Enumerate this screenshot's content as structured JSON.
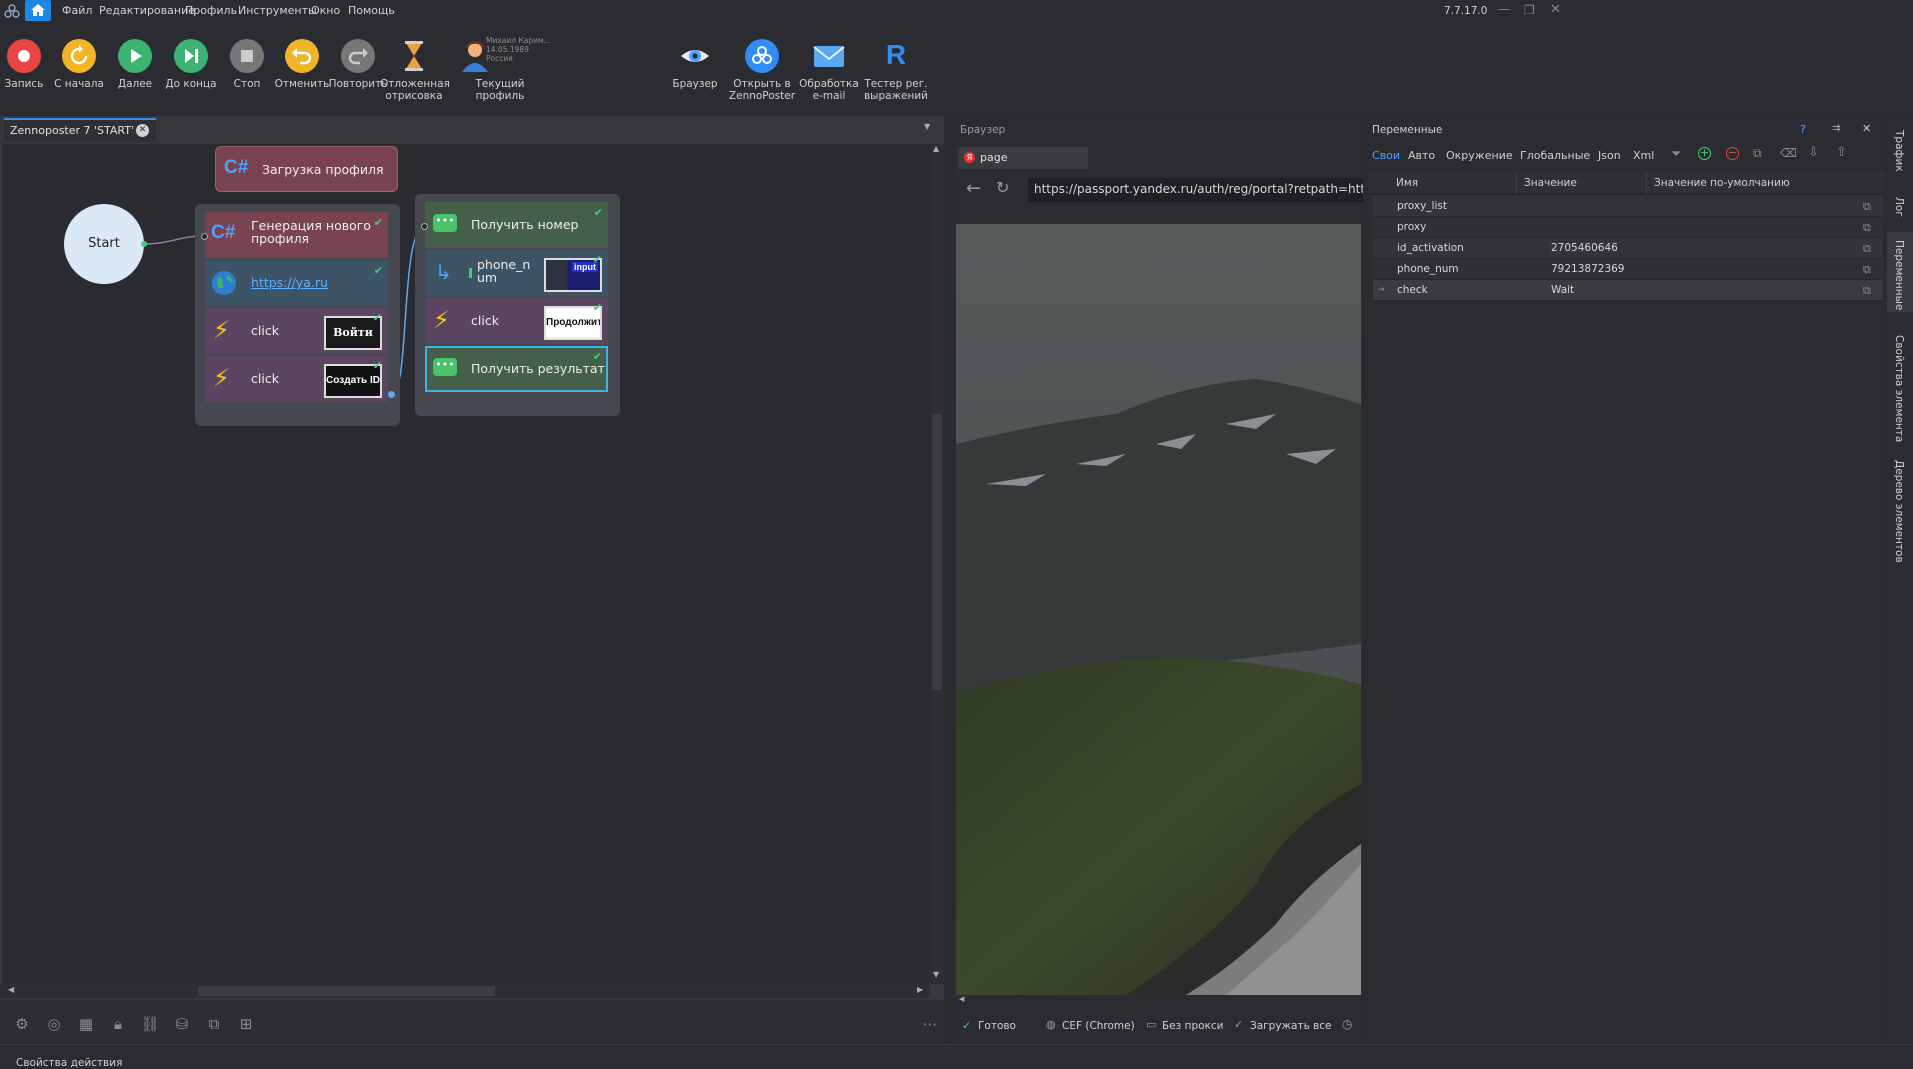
{
  "menu": {
    "items": [
      "Файл",
      "Редактирование",
      "Профиль",
      "Инструменты",
      "Окно",
      "Помощь"
    ],
    "version": "7.7.17.0"
  },
  "toolbar": {
    "buttons": [
      {
        "label": "Запись",
        "icon": "record-icon",
        "color": "#e84545"
      },
      {
        "label": "С начала",
        "icon": "restart-icon",
        "color": "#f0b429"
      },
      {
        "label": "Далее",
        "icon": "play-icon",
        "color": "#3cb371"
      },
      {
        "label": "До конца",
        "icon": "play-to-end-icon",
        "color": "#3cb371"
      },
      {
        "label": "Стоп",
        "icon": "stop-icon",
        "color": "#888888"
      },
      {
        "label": "Отменить",
        "icon": "undo-icon",
        "color": "#f0b429"
      },
      {
        "label": "Повторить",
        "icon": "redo-icon",
        "color": "#888888"
      },
      {
        "label": "Отложенная отрисовка",
        "icon": "hourglass-icon",
        "color": "#e8a33d"
      },
      {
        "label": "Текущий профиль",
        "icon": "profile-avatar-icon",
        "color": "#e8a33d"
      },
      {
        "label": "Браузер",
        "icon": "eye-icon",
        "color": "#4aa3ff"
      },
      {
        "label": "Открыть в ZennoPoster",
        "icon": "zennoposter-icon",
        "color": "#2f8df5"
      },
      {
        "label": "Обработка e-mail",
        "icon": "email-icon",
        "color": "#5aa8f0"
      },
      {
        "label": "Тестер рег. выражений",
        "icon": "regex-icon",
        "color": "#2f8df5"
      }
    ],
    "profile_info": [
      "Михаил Карим...",
      "14.05.1989",
      "Россия"
    ]
  },
  "project": {
    "tab_title": "Zennoposter 7 'START'",
    "start_label": "Start",
    "standalone_node": "Загрузка профиля",
    "group1": [
      {
        "label": "Генерация нового профиля",
        "icon": "csharp-icon"
      },
      {
        "label": "https://ya.ru",
        "icon": "globe-icon"
      },
      {
        "label": "click",
        "icon": "lightning-icon",
        "thumb": "Войти"
      },
      {
        "label": "click",
        "icon": "lightning-icon",
        "thumb": "Создать ID"
      }
    ],
    "group2": [
      {
        "label": "Получить номер",
        "icon": "chat-icon"
      },
      {
        "label": "phone_num",
        "icon": "set-variable-icon",
        "thumb": "input"
      },
      {
        "label": "click",
        "icon": "lightning-icon",
        "thumb": "Продолжит"
      },
      {
        "label": "Получить результат",
        "icon": "chat-icon"
      }
    ]
  },
  "bottom_status": "Свойства действия",
  "browser": {
    "panel_title": "Браузер",
    "tab_label": "page",
    "url": "https://passport.yandex.ru/auth/reg/portal?retpath=https",
    "status": [
      "Готово",
      "CEF (Chrome)",
      "Без прокси",
      "Загружать все"
    ]
  },
  "variables": {
    "panel_title": "Переменные",
    "help": "?",
    "tabs": [
      "Свои",
      "Авто",
      "Окружение",
      "Глобальные",
      "Json",
      "Xml"
    ],
    "columns": [
      "Имя",
      "Значение",
      "Значение по-умолчанию"
    ],
    "rows": [
      {
        "name": "proxy_list",
        "value": "",
        "default": ""
      },
      {
        "name": "proxy",
        "value": "",
        "default": ""
      },
      {
        "name": "id_activation",
        "value": "2705460646",
        "default": ""
      },
      {
        "name": "phone_num",
        "value": "79213872369",
        "default": ""
      },
      {
        "name": "check",
        "value": "Wait",
        "default": ""
      }
    ]
  },
  "side_tabs": [
    "Трафик",
    "Лог",
    "Переменные",
    "Свойства элемента",
    "Дерево элементов"
  ],
  "colors": {
    "accent": "#1e88e5",
    "node_csharp": "#7a4350",
    "node_nav": "#3d5466",
    "node_click": "#5b4560",
    "node_sms": "#45604a",
    "ok_green": "#3fd07a"
  }
}
